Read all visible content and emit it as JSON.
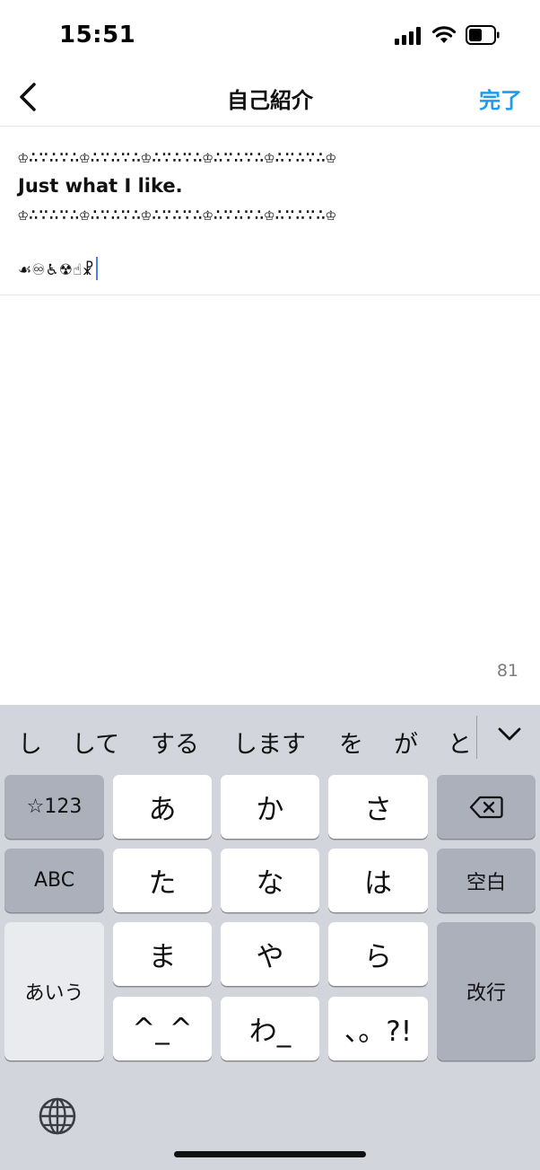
{
  "status_bar": {
    "time": "15:51"
  },
  "nav": {
    "title": "自己紹介",
    "done_label": "完了"
  },
  "bio": {
    "line1": "♔∴∵∴∵∴♔∴∵∴∵∴♔∴∵∴∵∴♔∴∵∴∵∴♔∴∵∴∵∴♔",
    "line2": "Just what I like.",
    "line3": "♔∴∵∴∵∴♔∴∵∴∵∴♔∴∵∴∵∴♔∴∵∴∵∴♔∴∵∴∵∴♔",
    "line4": "☙♾♿☢☝☧"
  },
  "counter": "81",
  "keyboard": {
    "candidates": [
      "し",
      "して",
      "する",
      "します",
      "を",
      "が",
      "と"
    ],
    "keys": {
      "mode_num": "☆123",
      "a": "あ",
      "ka": "か",
      "sa": "さ",
      "mode_abc": "ABC",
      "ta": "た",
      "na": "な",
      "ha": "は",
      "space": "空白",
      "mode_kana": "あいう",
      "ma": "ま",
      "ya": "や",
      "ra": "ら",
      "return": "改行",
      "face": "^_^",
      "wa": "わ_",
      "punct": "、。?!"
    }
  },
  "colors": {
    "accent": "#1d9bf0",
    "caret": "#4a7cf7",
    "keyboard_bg": "#d2d5db"
  },
  "icons": [
    "back-chevron-icon",
    "signal-icon",
    "wifi-icon",
    "battery-icon",
    "delete-icon",
    "chevron-down-icon",
    "globe-icon"
  ]
}
